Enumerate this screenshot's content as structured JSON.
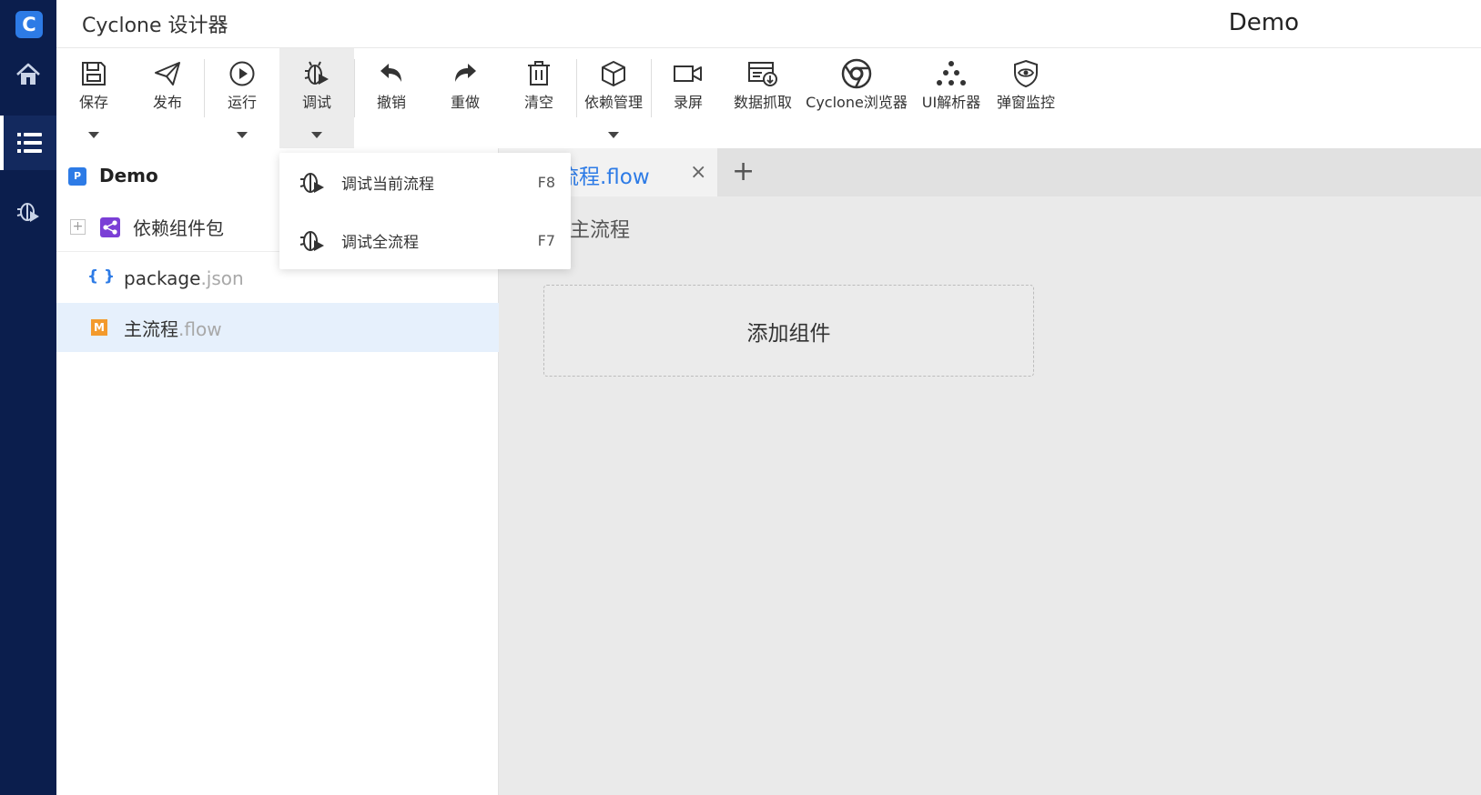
{
  "app": {
    "title": "Cyclone 设计器",
    "project_name": "Demo",
    "logo_letter": "C",
    "accent_color": "#2d7be6",
    "rail_color": "#0b1e4d"
  },
  "rail": {
    "items": [
      {
        "name": "home",
        "icon": "home-icon"
      },
      {
        "name": "project-list",
        "icon": "list-icon",
        "active": true
      },
      {
        "name": "debug",
        "icon": "bug-icon"
      }
    ]
  },
  "toolbar": {
    "save": "保存",
    "publish": "发布",
    "run": "运行",
    "debug": "调试",
    "undo": "撤销",
    "redo": "重做",
    "clear": "清空",
    "dependencies": "依赖管理",
    "record": "录屏",
    "data_capture": "数据抓取",
    "browser": "Cyclone浏览器",
    "ui_parser": "UI解析器",
    "popup_monitor": "弹窗监控"
  },
  "debug_menu": {
    "items": [
      {
        "label": "调试当前流程",
        "shortcut": "F8"
      },
      {
        "label": "调试全流程",
        "shortcut": "F7"
      }
    ]
  },
  "file_tree": {
    "project": "Demo",
    "project_badge": "P",
    "dependency_package": "依赖组件包",
    "expand_symbol": "+",
    "package_brace": "{ }",
    "package_name": "package",
    "package_ext": ".json",
    "flow_badge": "M",
    "flow_name": "主流程",
    "flow_ext": ".flow"
  },
  "editor": {
    "tab_label": "主流程.flow",
    "tab_close": "×",
    "tab_add": "+",
    "flow_title": "主流程",
    "add_component": "添加组件"
  }
}
